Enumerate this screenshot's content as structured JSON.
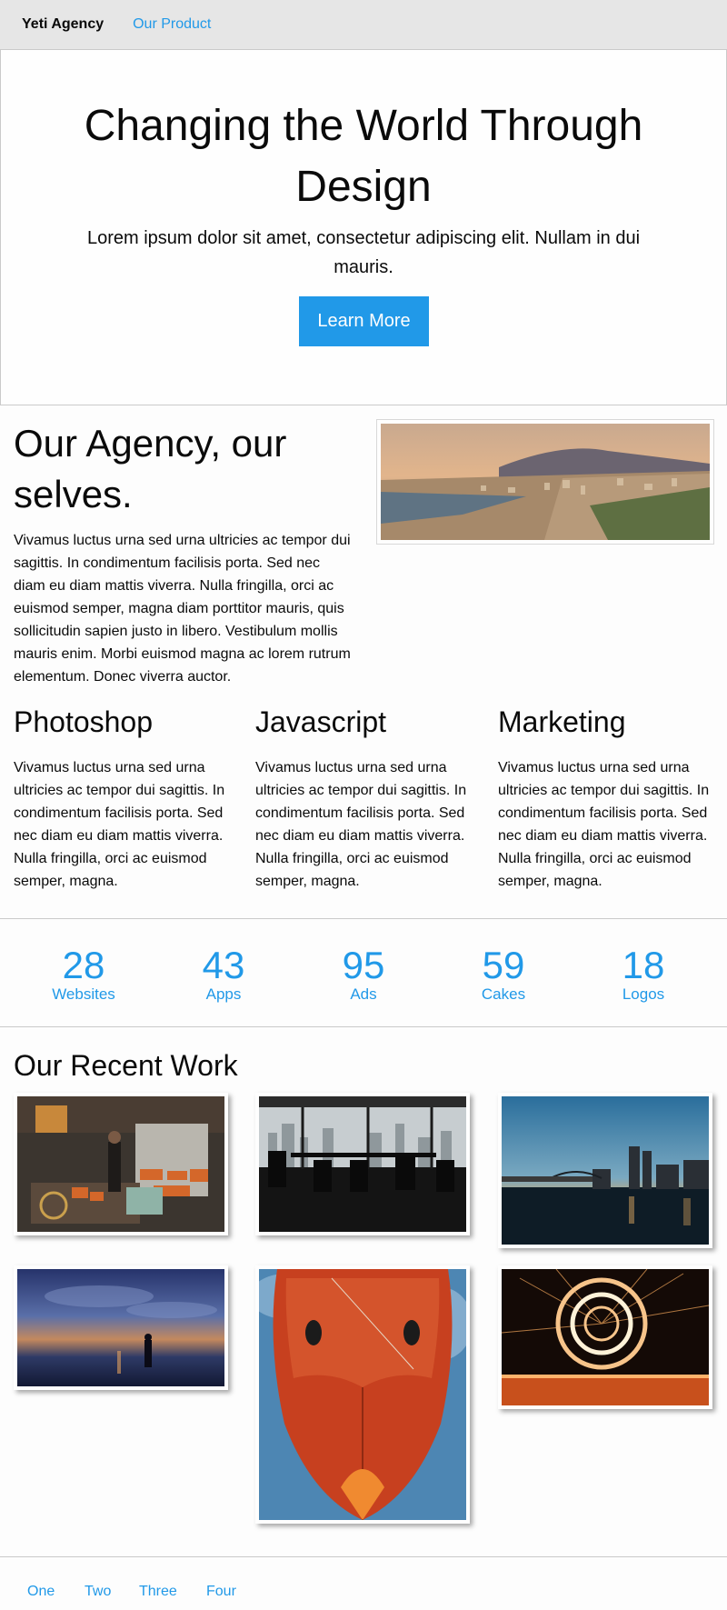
{
  "topbar": {
    "brand": "Yeti Agency",
    "nav": [
      "Our Product"
    ]
  },
  "hero": {
    "title": "Changing the World Through Design",
    "subtitle": "Lorem ipsum dolor sit amet, consectetur adipiscing elit. Nullam in dui mauris.",
    "button_label": "Learn More"
  },
  "about": {
    "title": "Our Agency, our selves.",
    "text": "Vivamus luctus urna sed urna ultricies ac tempor dui sagittis. In condimentum facilisis porta. Sed nec diam eu diam mattis viverra. Nulla fringilla, orci ac euismod semper, magna diam porttitor mauris, quis sollicitudin sapien justo in libero. Vestibulum mollis mauris enim. Morbi euismod magna ac lorem rutrum elementum. Donec viverra auctor."
  },
  "skills": [
    {
      "title": "Photoshop",
      "text": "Vivamus luctus urna sed urna ultricies ac tempor dui sagittis. In condimentum facilisis porta. Sed nec diam eu diam mattis viverra. Nulla fringilla, orci ac euismod semper, magna."
    },
    {
      "title": "Javascript",
      "text": "Vivamus luctus urna sed urna ultricies ac tempor dui sagittis. In condimentum facilisis porta. Sed nec diam eu diam mattis viverra. Nulla fringilla, orci ac euismod semper, magna."
    },
    {
      "title": "Marketing",
      "text": "Vivamus luctus urna sed urna ultricies ac tempor dui sagittis. In condimentum facilisis porta. Sed nec diam eu diam mattis viverra. Nulla fringilla, orci ac euismod semper, magna."
    }
  ],
  "stats": [
    {
      "value": "28",
      "label": "Websites"
    },
    {
      "value": "43",
      "label": "Apps"
    },
    {
      "value": "95",
      "label": "Ads"
    },
    {
      "value": "59",
      "label": "Cakes"
    },
    {
      "value": "18",
      "label": "Logos"
    }
  ],
  "work": {
    "title": "Our Recent Work"
  },
  "footer": {
    "links": [
      "One",
      "Two",
      "Three",
      "Four"
    ]
  },
  "colors": {
    "accent": "#2199e8",
    "topbar_bg": "#e6e6e6",
    "text": "#0a0a0a"
  }
}
